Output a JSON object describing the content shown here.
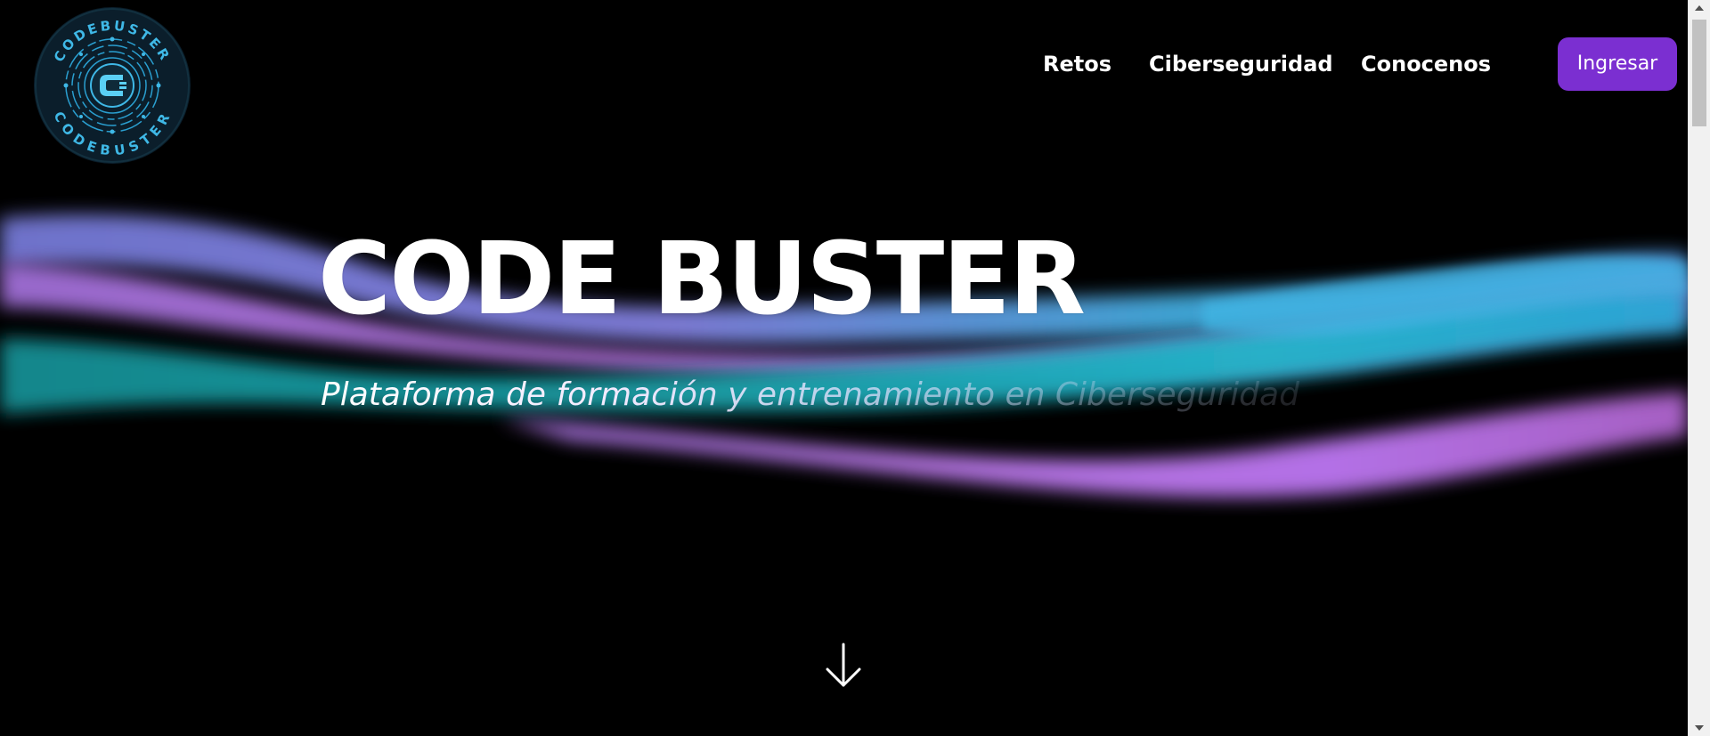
{
  "header": {
    "logo": {
      "top_text": "CODEBUSTER",
      "bottom_text": "CODEBUSTER",
      "icon": "codebuster-logo-icon"
    },
    "nav": {
      "items": [
        {
          "label": "Retos"
        },
        {
          "label": "Ciberseguridad"
        },
        {
          "label": "Conocenos"
        }
      ],
      "login_label": "Ingresar"
    }
  },
  "hero": {
    "title": "CODE BUSTER",
    "subtitle": "Plataforma de formación y entrenamiento en Ciberseguridad",
    "scroll_icon": "arrow-down-icon"
  },
  "colors": {
    "background": "#000000",
    "accent": "#7b2fd1",
    "wave_pink": "#c77dff",
    "wave_teal": "#1aa9b8",
    "wave_blue": "#4fb3ff",
    "logo_cyan": "#3fb8e6"
  }
}
